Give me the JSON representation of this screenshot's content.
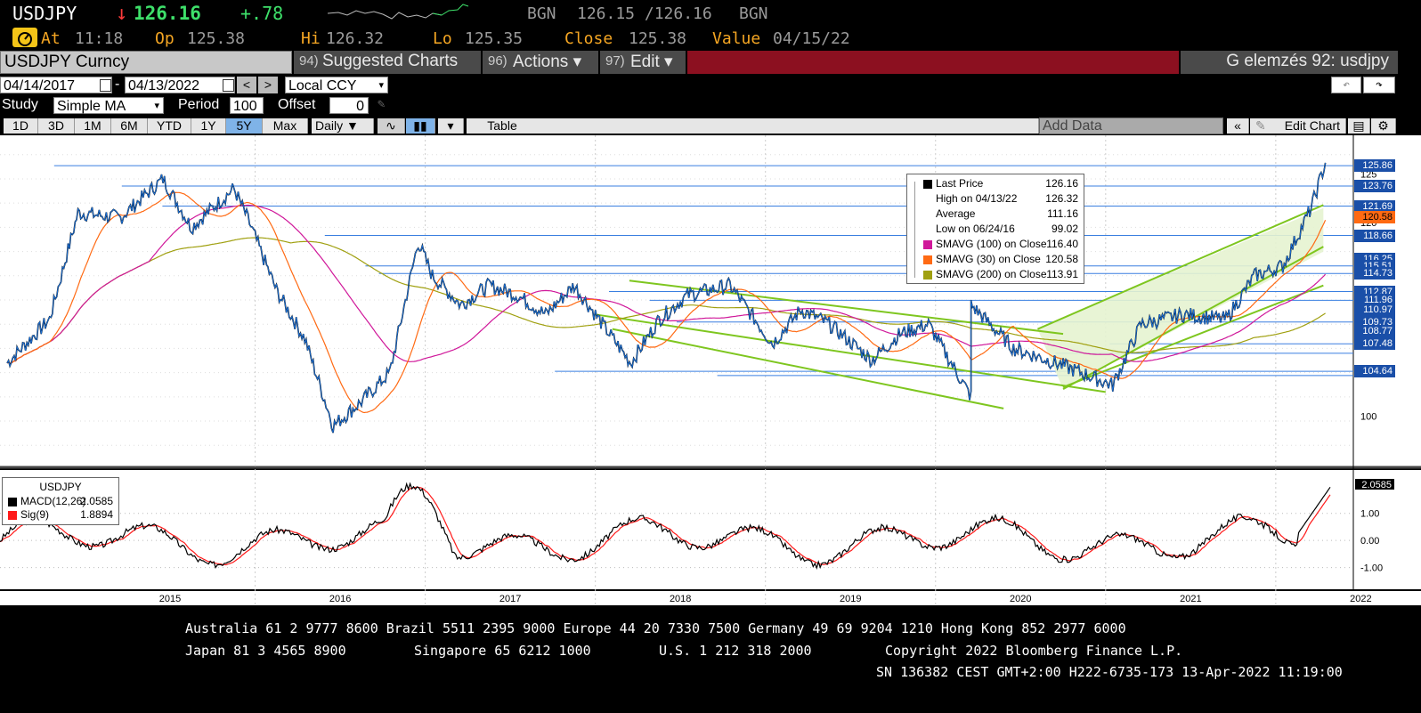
{
  "quote": {
    "ticker": "USDJPY",
    "arrow": "↓",
    "last": "126.16",
    "change": "+.78",
    "source_left": "BGN",
    "bid_ask": "126.15 /126.16",
    "source_right": "BGN",
    "at_label": "At",
    "at_time": "11:18",
    "open_label": "Op",
    "open": "125.38",
    "high_label": "Hi",
    "high": "126.32",
    "low_label": "Lo",
    "low": "125.35",
    "close_label": "Close",
    "close": "125.38",
    "value_label": "Value",
    "value_date": "04/15/22"
  },
  "menu": {
    "security": "USDJPY Curncy",
    "suggested_num": "94)",
    "suggested": "Suggested Charts",
    "actions_num": "96)",
    "actions": "Actions ▾",
    "edit_num": "97)",
    "edit": "Edit ▾",
    "analysis_title": "G elemzés 92: usdjpy"
  },
  "controls": {
    "date_from": "04/14/2017",
    "date_sep": "-",
    "date_to": "04/13/2022",
    "currency": "Local CCY",
    "study_label": "Study",
    "study_value": "Simple MA",
    "period_label": "Period",
    "period_value": "100",
    "offset_label": "Offset",
    "offset_value": "0",
    "add_data_placeholder": "Add Data",
    "edit_chart": "Edit Chart"
  },
  "timeframes": [
    "1D",
    "3D",
    "1M",
    "6M",
    "YTD",
    "1Y",
    "5Y",
    "Max"
  ],
  "selected_timeframe": "5Y",
  "frequency": "Daily ▼",
  "table_button": "Table",
  "legend": {
    "rows": [
      {
        "label": "Last Price",
        "value": "126.16",
        "color": "#000000"
      },
      {
        "label": "High on 04/13/22",
        "value": "126.32",
        "color": "none"
      },
      {
        "label": "Average",
        "value": "111.16",
        "color": "none"
      },
      {
        "label": "Low on 06/24/16",
        "value": "99.02",
        "color": "none"
      },
      {
        "label": "SMAVG (100)  on Close",
        "value": "116.40",
        "color": "#d0189a"
      },
      {
        "label": "SMAVG (30)   on Close",
        "value": "120.58",
        "color": "#ff6a13"
      },
      {
        "label": "SMAVG (200)  on Close",
        "value": "113.91",
        "color": "#a0a010"
      }
    ]
  },
  "macd_legend": {
    "title": "USDJPY",
    "rows": [
      {
        "label": "MACD(12,26)",
        "value": "2.0585",
        "color": "#000000"
      },
      {
        "label": "Sig(9)",
        "value": "1.8894",
        "color": "#ff1a1a"
      }
    ]
  },
  "price_tags": [
    "125.86",
    "123.76",
    "121.69",
    "120.58",
    "118.66",
    "116.25",
    "115.51",
    "114.73",
    "112.87",
    "111.96",
    "110.97",
    "109.73",
    "108.77",
    "107.48",
    "104.64"
  ],
  "axis_labels": {
    "y_price_top": "125",
    "y_price_mid": "120",
    "y_price_bottom": "100"
  },
  "chart_data": {
    "type": "line",
    "title": "",
    "x_labels": [
      "2015",
      "2016",
      "2017",
      "2018",
      "2019",
      "2020",
      "2021",
      "2022"
    ],
    "price_series": {
      "name": "Last Price",
      "points": [
        [
          "2014-07",
          105.5
        ],
        [
          "2014-10",
          110.0
        ],
        [
          "2014-12",
          121.0
        ],
        [
          "2015-03",
          120.5
        ],
        [
          "2015-06",
          124.5
        ],
        [
          "2015-08",
          119.5
        ],
        [
          "2015-11",
          123.5
        ],
        [
          "2015-12",
          120.3
        ],
        [
          "2016-02",
          113.0
        ],
        [
          "2016-04",
          108.0
        ],
        [
          "2016-06",
          99.0
        ],
        [
          "2016-08",
          101.5
        ],
        [
          "2016-10",
          104.5
        ],
        [
          "2016-12",
          118.0
        ],
        [
          "2017-01",
          114.5
        ],
        [
          "2017-03",
          111.5
        ],
        [
          "2017-05",
          113.5
        ],
        [
          "2017-07",
          112.5
        ],
        [
          "2017-09",
          110.5
        ],
        [
          "2017-11",
          113.5
        ],
        [
          "2018-01",
          109.5
        ],
        [
          "2018-03",
          105.5
        ],
        [
          "2018-05",
          110.0
        ],
        [
          "2018-07",
          112.5
        ],
        [
          "2018-10",
          113.5
        ],
        [
          "2019-01",
          107.5
        ],
        [
          "2019-03",
          111.0
        ],
        [
          "2019-05",
          109.5
        ],
        [
          "2019-08",
          105.8
        ],
        [
          "2019-10",
          108.5
        ],
        [
          "2019-12",
          109.5
        ],
        [
          "2020-03",
          102.0
        ],
        [
          "2020-03",
          111.5
        ],
        [
          "2020-06",
          107.0
        ],
        [
          "2020-09",
          105.5
        ],
        [
          "2021-01",
          103.2
        ],
        [
          "2021-03",
          109.5
        ],
        [
          "2021-06",
          110.5
        ],
        [
          "2021-09",
          110.0
        ],
        [
          "2021-11",
          114.5
        ],
        [
          "2022-01",
          115.5
        ],
        [
          "2022-03",
          121.5
        ],
        [
          "2022-04",
          126.16
        ]
      ]
    },
    "sma30_last": 120.58,
    "sma100_last": 116.4,
    "sma200_last": 113.91,
    "macd_series": {
      "name": "MACD(12,26)",
      "last": 2.0585,
      "y_ticks": [
        "1.00",
        "0.00",
        "-1.00"
      ]
    },
    "signal_last": 1.8894
  },
  "footer": {
    "line1": "Australia 61 2 9777 8600 Brazil 5511 2395 9000 Europe 44 20 7330 7500 Germany 49 69 9204 1210 Hong Kong 852 2977 6000",
    "line2a": "Japan 81 3 4565 8900",
    "line2b": "Singapore 65 6212 1000",
    "line2c": "U.S. 1 212 318 2000",
    "line2d": "Copyright 2022 Bloomberg Finance L.P.",
    "line3": "SN 136382 CEST GMT+2:00 H222-6735-173 13-Apr-2022 11:19:00"
  },
  "colors": {
    "price": "#1a6fd6",
    "sma30": "#ff6a13",
    "sma100": "#d0189a",
    "sma200": "#a0a010",
    "trend": "#7ec61f",
    "hline": "#3a7fe0"
  }
}
